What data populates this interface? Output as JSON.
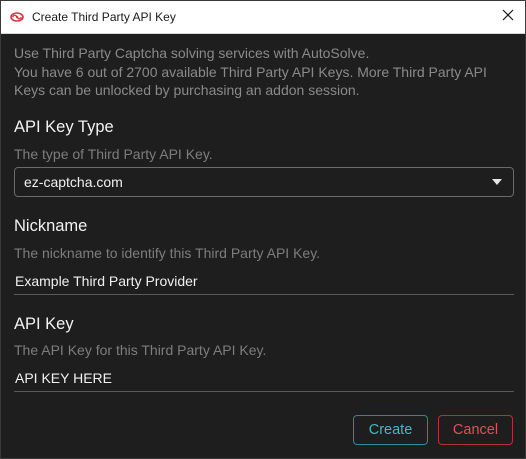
{
  "window": {
    "title": "Create Third Party API Key",
    "app_icon": "autosolve-logo-icon",
    "close_icon": "close-icon"
  },
  "description": {
    "line1": "Use Third Party Captcha solving services with AutoSolve.",
    "line2": "You have 6 out of 2700 available Third Party API Keys. More Third Party API",
    "line3": "Keys can be unlocked by purchasing an addon session."
  },
  "api_key_type": {
    "label": "API Key Type",
    "hint": "The type of Third Party API Key.",
    "selected": "ez-captcha.com"
  },
  "nickname": {
    "label": "Nickname",
    "hint": "The nickname to identify this Third Party API Key.",
    "value": "Example Third Party Provider"
  },
  "api_key": {
    "label": "API Key",
    "hint": "The API Key for this Third Party API Key.",
    "value": "API KEY HERE"
  },
  "actions": {
    "create_label": "Create",
    "cancel_label": "Cancel"
  },
  "colors": {
    "background": "#1e1e1e",
    "accent_create": "#45b8c8",
    "accent_cancel": "#e0505a",
    "logo": "#d4363f"
  }
}
